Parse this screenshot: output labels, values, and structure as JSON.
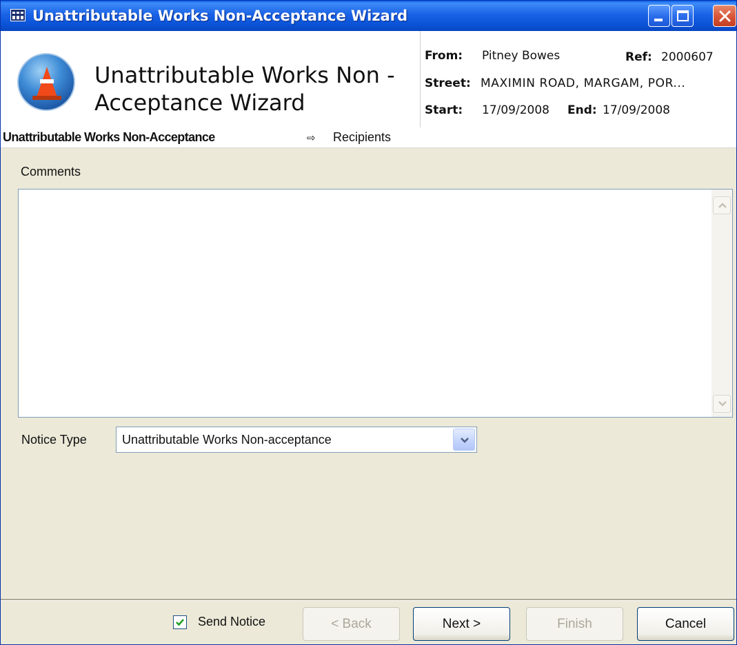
{
  "window": {
    "title": "Unattributable Works Non-Acceptance Wizard",
    "icon": "app-icon"
  },
  "header": {
    "title": "Unattributable Works Non -Acceptance Wizard",
    "logo_icon": "traffic-cone-icon",
    "from_label": "From:",
    "from_value": "Pitney Bowes",
    "ref_label": "Ref:",
    "ref_value": "2000607",
    "street_label": "Street:",
    "street_value": "MAXIMIN ROAD, MARGAM, POR...",
    "start_label": "Start:",
    "start_value": "17/09/2008",
    "end_label": "End:",
    "end_value": "17/09/2008"
  },
  "breadcrumb": {
    "current": "Unattributable Works Non-Acceptance",
    "separator": "⇨",
    "next": "Recipients"
  },
  "form": {
    "comments_label": "Comments",
    "comments_value": "",
    "notice_type_label": "Notice Type",
    "notice_type_value": "Unattributable Works Non-acceptance"
  },
  "footer": {
    "send_notice_label": "Send Notice",
    "send_notice_checked": true,
    "back_label": "< Back",
    "next_label": "Next >",
    "finish_label": "Finish",
    "cancel_label": "Cancel"
  },
  "colors": {
    "titlebar": "#0C55D9",
    "dialog_bg": "#ECE9D8",
    "close_button": "#D9583A"
  }
}
